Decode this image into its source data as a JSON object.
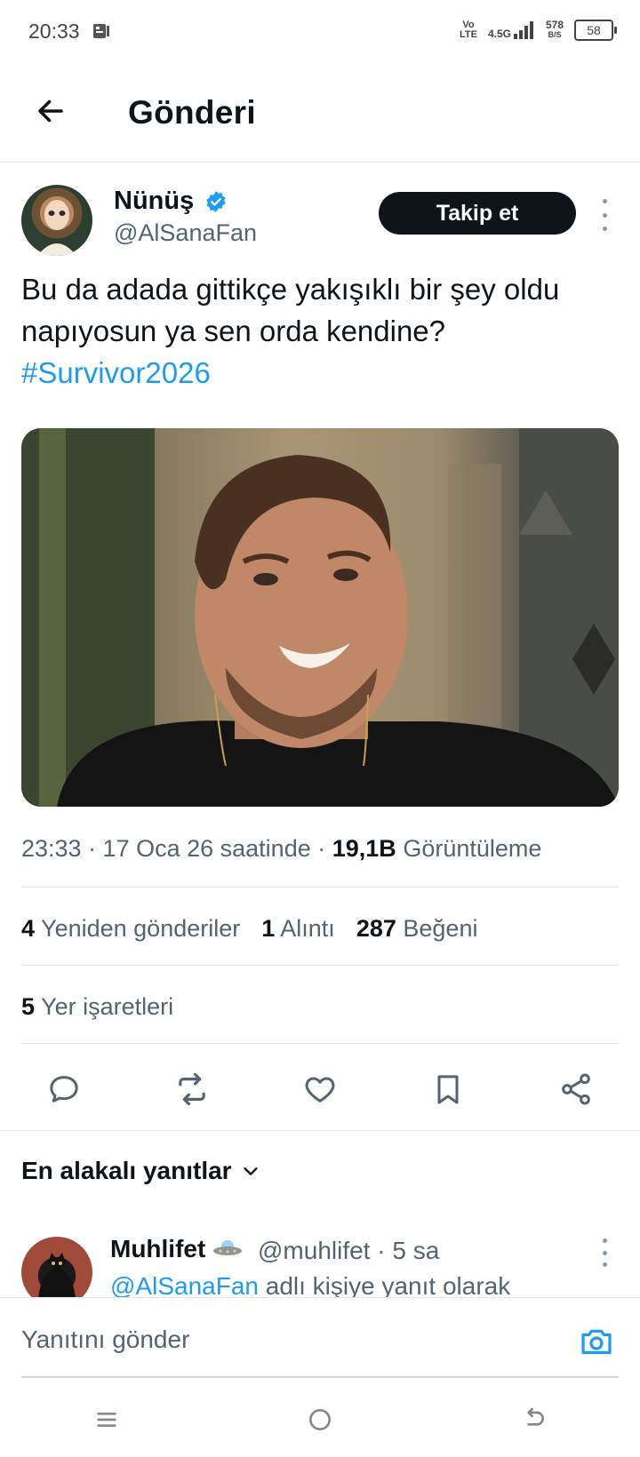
{
  "status_bar": {
    "time": "20:33",
    "net_vo": "Vo",
    "net_lte": "LTE",
    "net_type": "4.5G",
    "speed_value": "578",
    "speed_unit": "B/S",
    "battery": "58"
  },
  "header": {
    "title": "Gönderi"
  },
  "tweet": {
    "author_name": "Nünüş",
    "author_handle": "@AlSanaFan",
    "follow_label": "Takip et",
    "text": "Bu da adada gittikçe yakışıklı bir şey oldu napıyosun ya sen orda kendine?",
    "hashtag": "#Survivor2026",
    "time": "23:33 · 17 Oca 26 saatinde ·",
    "views_count": "19,1B",
    "views_label": "Görüntüleme",
    "reposts_count": "4",
    "reposts_label": "Yeniden gönderiler",
    "quotes_count": "1",
    "quotes_label": "Alıntı",
    "likes_count": "287",
    "likes_label": "Beğeni",
    "bookmarks_count": "5",
    "bookmarks_label": "Yer işaretleri"
  },
  "replies": {
    "sort_label": "En alakalı yanıtlar",
    "items": [
      {
        "name": "Muhlifet",
        "handle": "@muhlifet · 5 sa",
        "replying_to": "@AlSanaFan",
        "replying_suffix": " adlı kişiye yanıt olarak"
      }
    ]
  },
  "composer": {
    "placeholder": "Yanıtını gönder"
  },
  "colors": {
    "accent": "#1d9bf0",
    "text": "#0f1419",
    "secondary": "#536471"
  }
}
